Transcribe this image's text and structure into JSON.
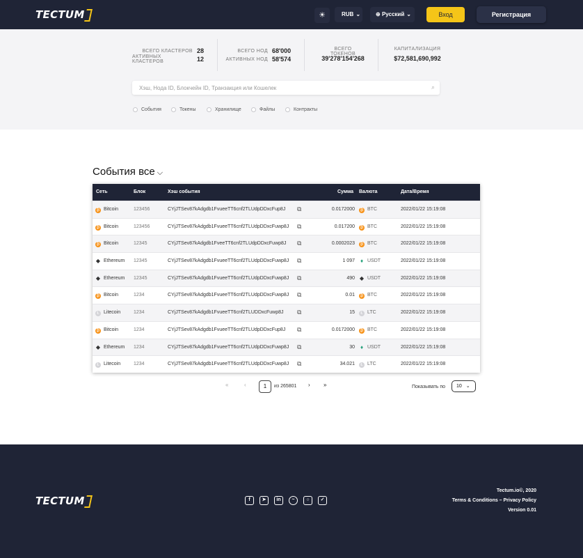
{
  "header": {
    "logo": "TECTUM",
    "theme_icon": "☀",
    "currency": "RUB",
    "language": "Русский",
    "login": "Вход",
    "register": "Регистрация"
  },
  "stats": {
    "clusters_total_label": "ВСЕГО КЛАСТЕРОВ",
    "clusters_total": "28",
    "clusters_active_label": "АКТИВНЫХ КЛАСТЕРОВ",
    "clusters_active": "12",
    "nodes_total_label": "ВСЕГО НОД",
    "nodes_total": "68'000",
    "nodes_active_label": "АКТИВНЫХ НОД",
    "nodes_active": "58'574",
    "tokens_label": "ВСЕГО ТОКЕНОВ",
    "tokens": "39'278'154'268",
    "cap_label": "КАПИТАЛИЗАЦИЯ",
    "cap": "$72,581,690,992"
  },
  "search": {
    "placeholder": "Хэш, Нода ID, Блокчейн ID, Транзакция или Кошелек"
  },
  "filters": [
    "События",
    "Токены",
    "Хранилище",
    "Файлы",
    "Контракты"
  ],
  "events": {
    "title": "События все",
    "columns": [
      "Сеть",
      "Блок",
      "Хэш события",
      "Сумма",
      "Валюта",
      "Дата/Время"
    ],
    "rows": [
      {
        "net": "Bitcoin",
        "net_icon": "btc",
        "block": "123456",
        "hash": "CYjJTSev87kAdgdb1FvueeTT6cnf2TLUdpDDxcFup8J",
        "sum": "0.0172000",
        "cur": "BTC",
        "cur_icon": "btc",
        "date": "2022/01/22 15:19:08"
      },
      {
        "net": "Bitcoin",
        "net_icon": "btc",
        "block": "123456",
        "hash": "CYjJTSev87kAdgdb1FvueeTT6cnf2TLUdpDDxcFuwp8J",
        "sum": "0.017200",
        "cur": "BTC",
        "cur_icon": "btc",
        "date": "2022/01/22 15:19:08"
      },
      {
        "net": "Bitcoin",
        "net_icon": "btc",
        "block": "12345",
        "hash": "CYjJTSev87kAdgdb1FveeTT6cnf2TLUdpDDxcFuwp8J",
        "sum": "0.0002023",
        "cur": "BTC",
        "cur_icon": "btc",
        "date": "2022/01/22 15:19:08"
      },
      {
        "net": "Ethereum",
        "net_icon": "eth",
        "block": "12345",
        "hash": "CYjJTSev87kAdgdb1FvueeTT6cnf2TLUdpDDxcFuwp8J",
        "sum": "1 097",
        "cur": "USDT",
        "cur_icon": "usdt",
        "date": "2022/01/22 15:19:08"
      },
      {
        "net": "Ethereum",
        "net_icon": "eth",
        "block": "12345",
        "hash": "CYjJTSev87kAdgdb1FvueeTT6cnf2TLUdpDDxcFuwp8J",
        "sum": "490",
        "cur": "USDT",
        "cur_icon": "eth",
        "date": "2022/01/22 15:19:08"
      },
      {
        "net": "Bitcoin",
        "net_icon": "btc",
        "block": "1234",
        "hash": "CYjJTSev87kAdgdb1FvueeTT6cnf2TLUdpDDxcFuwp8J",
        "sum": "0.01",
        "cur": "BTC",
        "cur_icon": "btc",
        "date": "2022/01/22 15:19:08"
      },
      {
        "net": "Litecoin",
        "net_icon": "ltc",
        "block": "1234",
        "hash": "CYjJTSev87kAdgdb1FvueeTT6cnf2TLUDDxcFuwp8J",
        "sum": "15",
        "cur": "LTC",
        "cur_icon": "ltc",
        "date": "2022/01/22 15:19:08"
      },
      {
        "net": "Bitcoin",
        "net_icon": "btc",
        "block": "1234",
        "hash": "CYjJTSev87kAdgdb1FvueeTT6cnf2TLUdpDDxcFup8J",
        "sum": "0.0172000",
        "cur": "BTC",
        "cur_icon": "btc",
        "date": "2022/01/22 15:19:08"
      },
      {
        "net": "Ethereum",
        "net_icon": "eth",
        "block": "1234",
        "hash": "CYjJTSev87kAdgdb1FvueeTT6cnf2TLUdpDDxcFuwp8J",
        "sum": "30",
        "cur": "USDT",
        "cur_icon": "usdt",
        "date": "2022/01/22 15:19:08"
      },
      {
        "net": "Litecoin",
        "net_icon": "ltc",
        "block": "1234",
        "hash": "CYjJTSev87kAdgdb1FvueeTT6cnf2TLUdpDDxcFuwp8J",
        "sum": "34.021",
        "cur": "LTC",
        "cur_icon": "ltc",
        "date": "2022/01/22 15:19:08"
      }
    ]
  },
  "pagination": {
    "first": "«",
    "prev": "‹",
    "current": "1",
    "of": "из 265801",
    "next": "›",
    "last": "»",
    "show_label": "Показывать по",
    "per_page": "10"
  },
  "footer": {
    "logo": "TECTUM",
    "copyright": "Tectum.io©, 2020",
    "terms": "Terms & Conditions – Privacy Policy",
    "version": "Version 0.01",
    "socials": [
      "facebook-icon",
      "telegram-icon",
      "linkedin-icon",
      "messenger-icon",
      "instagram-icon",
      "twitter-icon"
    ]
  },
  "colors": {
    "dark": "#1f2436",
    "accent": "#f5c518",
    "light_bg": "#f4f4f6"
  }
}
